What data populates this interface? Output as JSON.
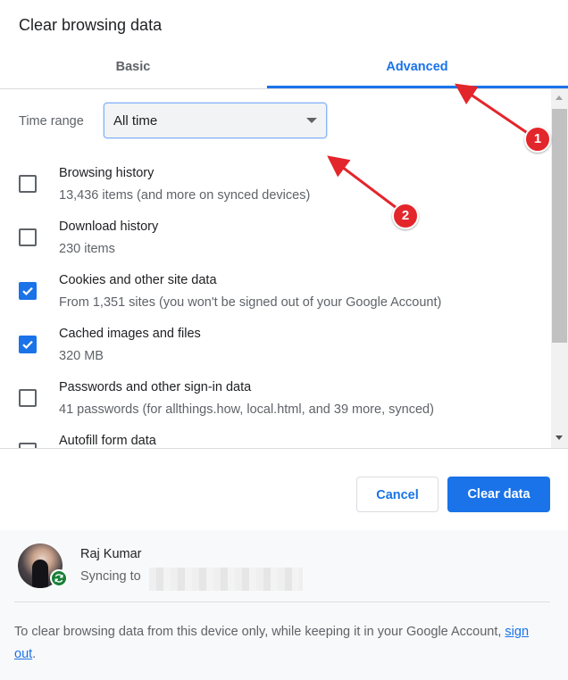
{
  "dialog": {
    "title": "Clear browsing data"
  },
  "tabs": [
    {
      "label": "Basic",
      "selected": false
    },
    {
      "label": "Advanced",
      "selected": true
    }
  ],
  "time_range": {
    "label": "Time range",
    "value": "All time"
  },
  "items": [
    {
      "title": "Browsing history",
      "subtitle": "13,436 items (and more on synced devices)",
      "checked": false
    },
    {
      "title": "Download history",
      "subtitle": "230 items",
      "checked": false
    },
    {
      "title": "Cookies and other site data",
      "subtitle": "From 1,351 sites (you won't be signed out of your Google Account)",
      "checked": true
    },
    {
      "title": "Cached images and files",
      "subtitle": "320 MB",
      "checked": true
    },
    {
      "title": "Passwords and other sign-in data",
      "subtitle": "41 passwords (for allthings.how, local.html, and 39 more, synced)",
      "checked": false
    },
    {
      "title": "Autofill form data",
      "subtitle": "",
      "checked": false
    }
  ],
  "buttons": {
    "cancel": "Cancel",
    "clear": "Clear data"
  },
  "account": {
    "name": "Raj Kumar",
    "syncing_label": "Syncing to"
  },
  "footer": {
    "text_before": "To clear browsing data from this device only, while keeping it in your Google Account, ",
    "link": "sign out",
    "text_after": "."
  },
  "annotations": [
    {
      "label": "1"
    },
    {
      "label": "2"
    }
  ],
  "colors": {
    "accent": "#1a73e8",
    "annotation": "#e3262b",
    "sync_badge": "#188038"
  }
}
